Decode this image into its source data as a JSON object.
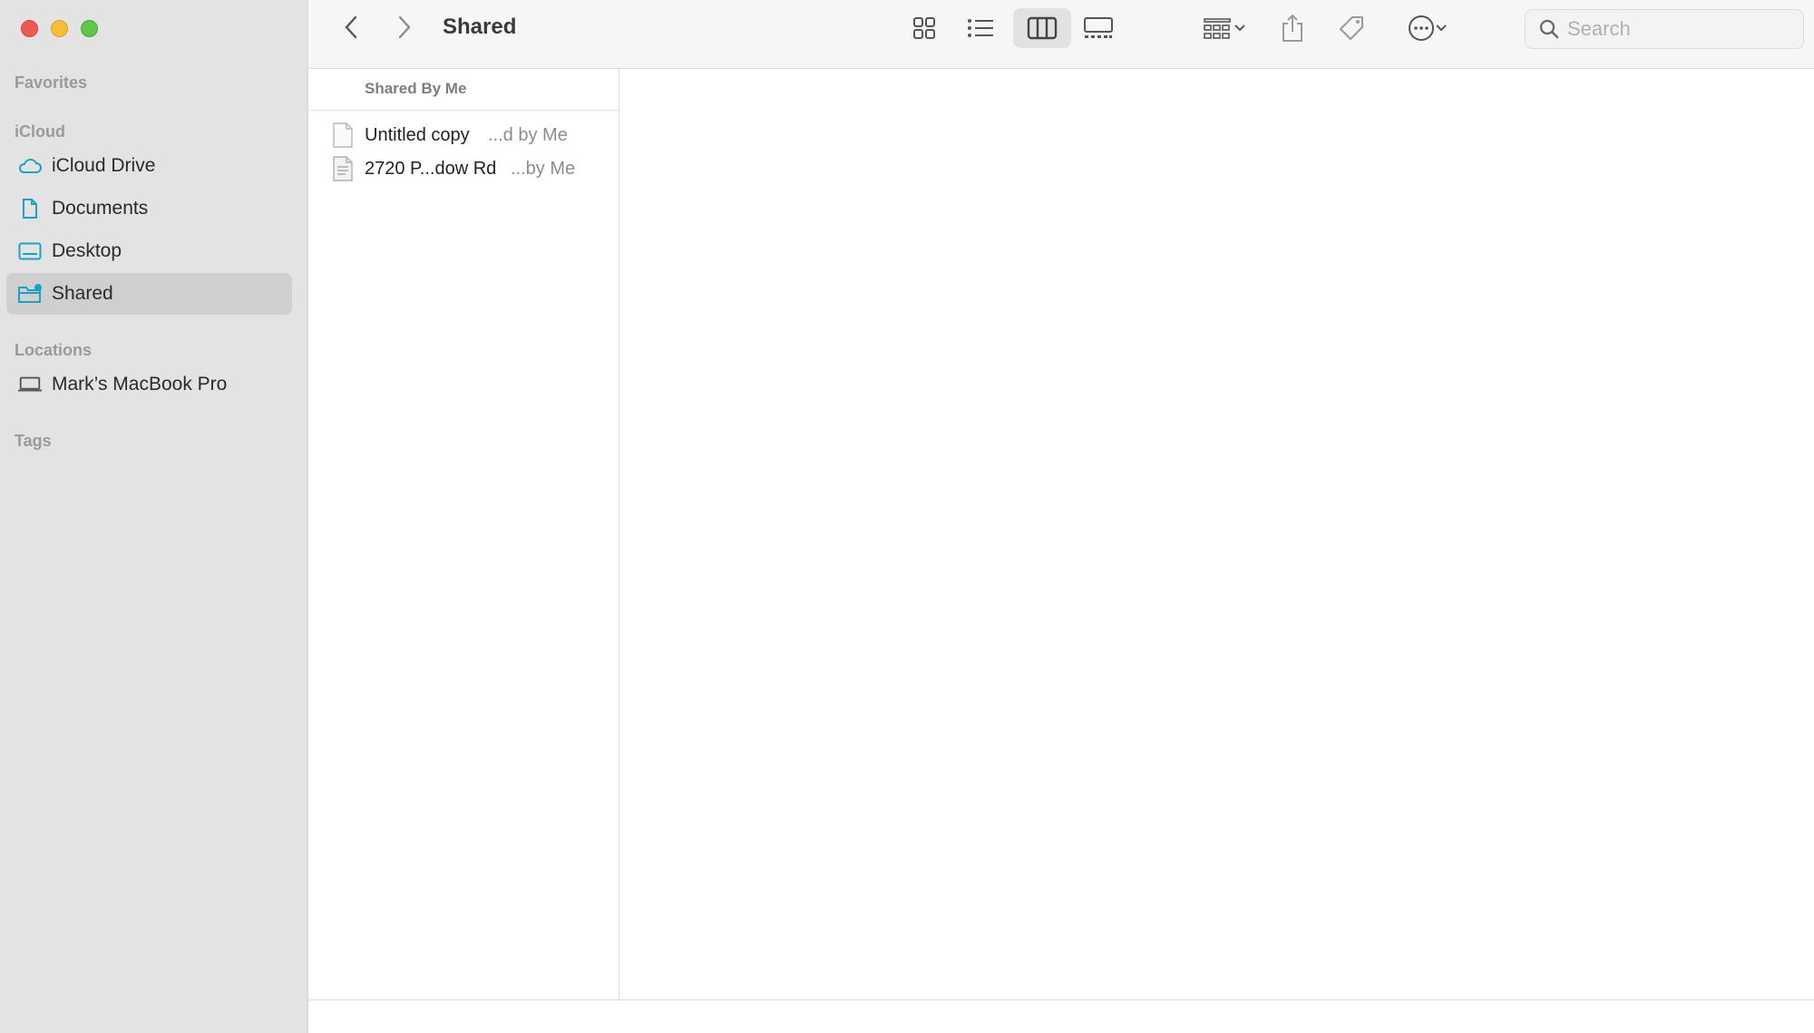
{
  "window": {
    "title": "Shared"
  },
  "sidebar": {
    "sections": {
      "favorites": "Favorites",
      "icloud": "iCloud",
      "locations": "Locations",
      "tags": "Tags"
    },
    "icloud_items": [
      {
        "label": "iCloud Drive",
        "icon": "cloud-icon"
      },
      {
        "label": "Documents",
        "icon": "document-icon"
      },
      {
        "label": "Desktop",
        "icon": "desktop-icon"
      },
      {
        "label": "Shared",
        "icon": "shared-folder-icon",
        "selected": true
      }
    ],
    "location_items": [
      {
        "label": "Mark’s MacBook Pro",
        "icon": "laptop-icon"
      }
    ]
  },
  "toolbar": {
    "search_placeholder": "Search"
  },
  "column": {
    "header": "Shared By Me",
    "files": [
      {
        "name": "Untitled copy",
        "sub": "...d by Me"
      },
      {
        "name": "2720 P...dow Rd",
        "sub": "...by Me"
      }
    ]
  },
  "colors": {
    "accent": "#1ba1c8",
    "sidebar_bg": "#e3e3e3",
    "selected_bg": "#cfcfcf"
  }
}
